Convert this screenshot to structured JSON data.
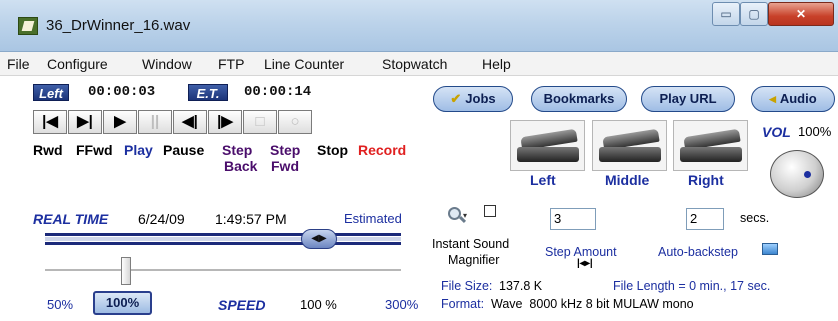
{
  "window": {
    "title": "36_DrWinner_16.wav",
    "controls": {
      "minimize": "▭",
      "maximize": "▢",
      "close": "✕"
    }
  },
  "menu": [
    "File",
    "Configure",
    "Window",
    "FTP",
    "Line Counter",
    "Stopwatch",
    "Help"
  ],
  "timers": {
    "left_badge": "Left",
    "left_time": "00:00:03",
    "et_badge": "E.T.",
    "et_time": "00:00:14"
  },
  "transport": {
    "buttons": [
      "|◀",
      "▶|",
      "▶",
      "||",
      "◀|",
      "|▶",
      "□",
      "○"
    ],
    "labels": {
      "rwd": "Rwd",
      "ffwd": "FFwd",
      "play": "Play",
      "pause": "Pause",
      "step_back_1": "Step",
      "step_back_2": "Back",
      "step_fwd_1": "Step",
      "step_fwd_2": "Fwd",
      "stop": "Stop",
      "record": "Record"
    }
  },
  "toolbar": {
    "jobs": "Jobs",
    "bookmarks": "Bookmarks",
    "play_url": "Play URL",
    "audio": "Audio"
  },
  "pedals": [
    "Left",
    "Middle",
    "Right"
  ],
  "volume": {
    "label": "VOL",
    "value": "100%"
  },
  "realtime": {
    "label": "REAL TIME",
    "date": "6/24/09",
    "time": "1:49:57 PM",
    "estimated": "Estimated",
    "position_fraction": 0.8
  },
  "speed": {
    "min": "50%",
    "current_button": "100%",
    "label": "SPEED",
    "value": "100 %",
    "max": "300%"
  },
  "magnifier": {
    "line1": "Instant Sound",
    "line2": "Magnifier"
  },
  "step": {
    "amount_value": "3",
    "amount_label": "Step Amount",
    "autobackstep_value": "2",
    "autobackstep_label": "Auto-backstep",
    "unit": "secs."
  },
  "file": {
    "size_label": "File Size:",
    "size_value": "137.8 K",
    "length_text": "File Length = 0 min., 17 sec.",
    "format_label": "Format:",
    "format_value": "Wave  8000 kHz 8 bit MULAW mono"
  },
  "colors": {
    "accent": "#1c2fa0",
    "record": "#e02020",
    "titlebar": "#bcd3ea"
  }
}
